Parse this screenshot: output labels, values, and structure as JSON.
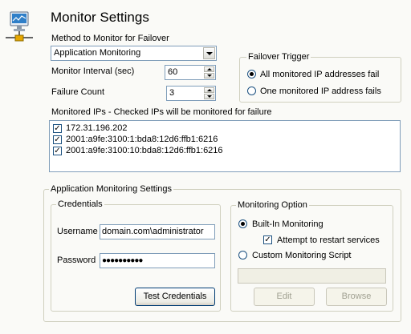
{
  "title": "Monitor Settings",
  "method_label": "Method to Monitor for Failover",
  "method_value": "Application Monitoring",
  "interval_label": "Monitor Interval (sec)",
  "interval_value": "60",
  "failure_label": "Failure Count",
  "failure_value": "3",
  "failover_trigger": {
    "label": "Failover Trigger",
    "option_all": "All monitored IP addresses fail",
    "option_one": "One monitored IP address fails",
    "selected": "all"
  },
  "monitored_ips": {
    "label": "Monitored IPs - Checked IPs will be monitored for failure",
    "items": [
      {
        "ip": "172.31.196.202",
        "checked": true
      },
      {
        "ip": "2001:a9fe:3100:1:bda8:12d6:ffb1:6216",
        "checked": true
      },
      {
        "ip": "2001:a9fe:3100:10:bda8:12d6:ffb1:6216",
        "checked": true
      }
    ]
  },
  "app_settings": {
    "label": "Application Monitoring Settings",
    "credentials": {
      "label": "Credentials",
      "username_label": "Username",
      "username_value": "domain.com\\administrator",
      "password_label": "Password",
      "password_value": "●●●●●●●●●●",
      "test_button": "Test Credentials"
    },
    "monitoring_option": {
      "label": "Monitoring Option",
      "builtin": "Built-In Monitoring",
      "restart": "Attempt to restart services",
      "restart_checked": true,
      "custom": "Custom Monitoring Script",
      "selected": "builtin",
      "edit_button": "Edit",
      "browse_button": "Browse"
    }
  }
}
